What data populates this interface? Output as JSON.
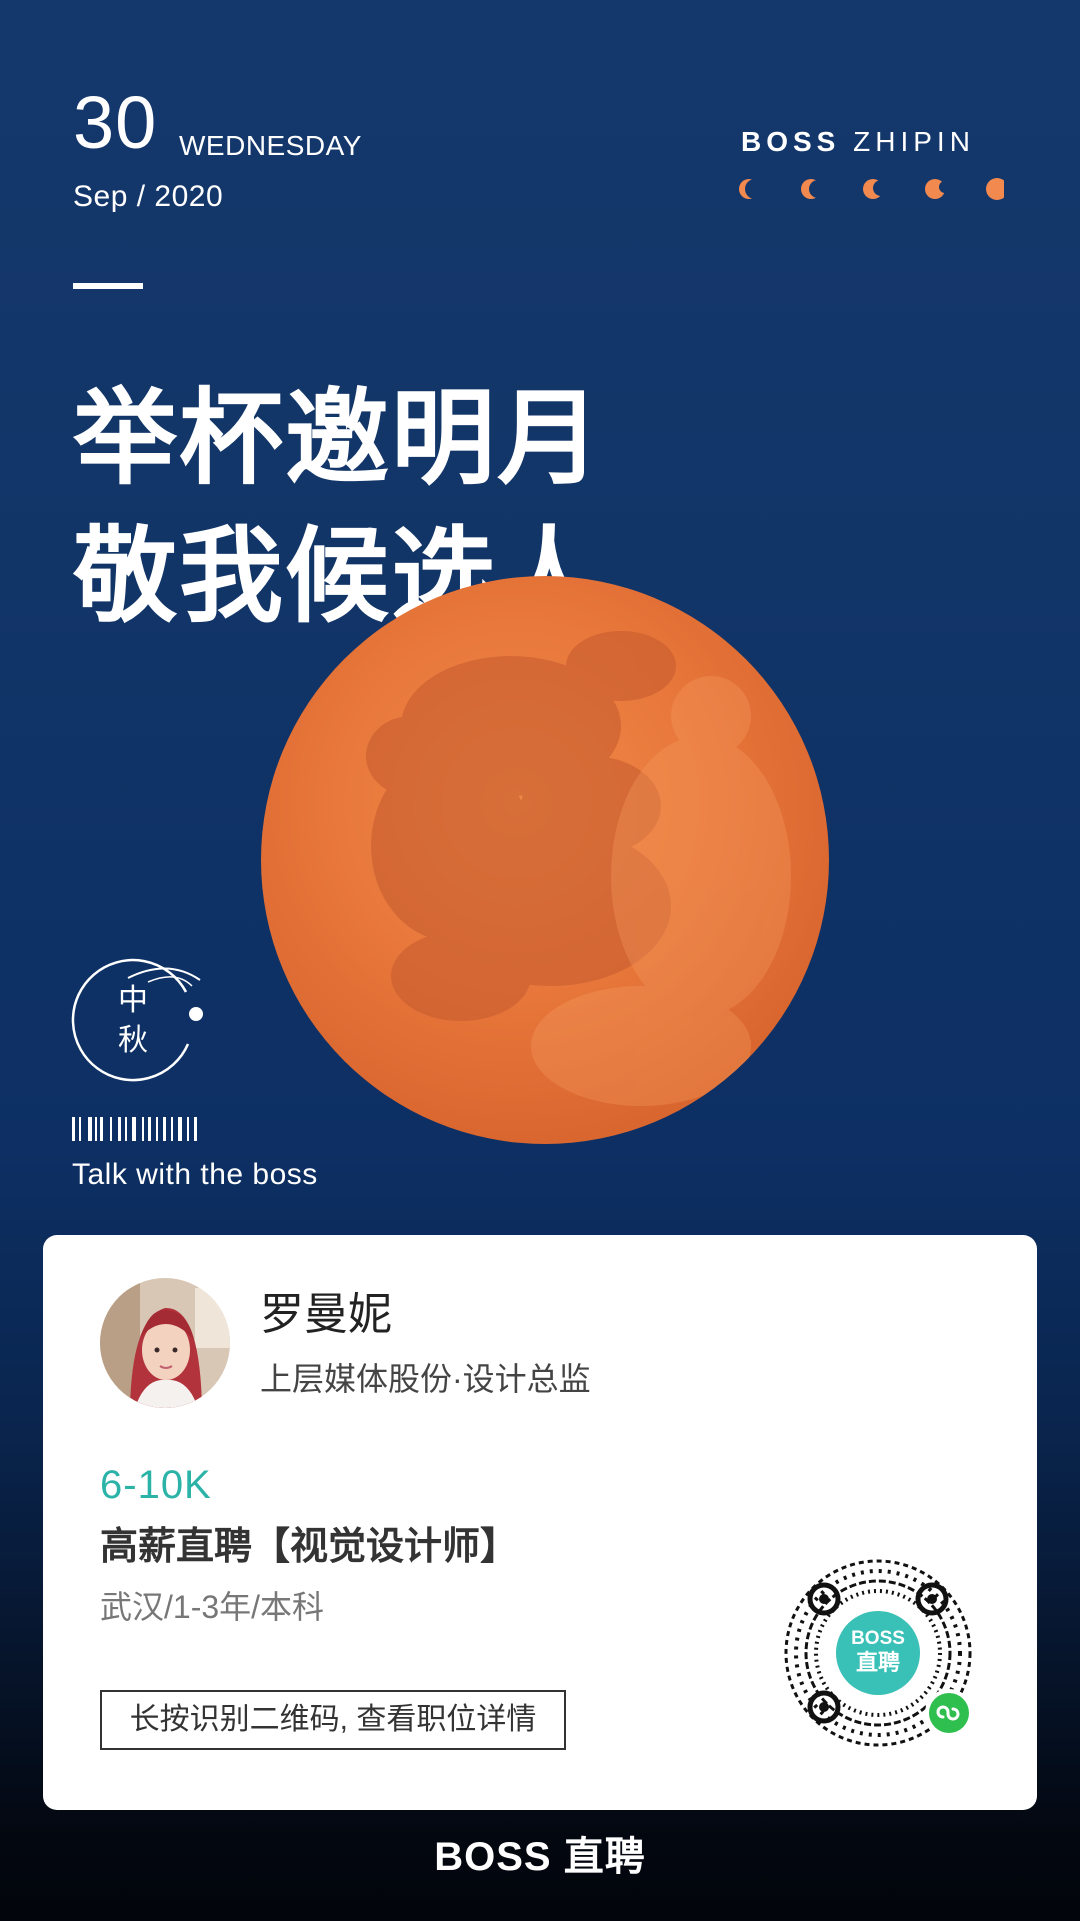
{
  "poster": {
    "date": {
      "day": "30",
      "weekday": "WEDNESDAY",
      "month_year": "Sep / 2020"
    },
    "brand_top": {
      "part1": "BOSS",
      "part2": "ZHIPIN"
    },
    "headline": {
      "line1": "举杯邀明月",
      "line2": "敬我候选人"
    },
    "seal": {
      "char1": "中",
      "char2": "秋"
    },
    "tagline": "Talk with the boss",
    "colors": {
      "background": "#123568",
      "moon": "#e8743a",
      "accent": "#2bb3a8",
      "qr_badge": "#3ac1b7"
    },
    "icons": [
      "moon-phase-icon",
      "mid-autumn-seal",
      "barcode-decoration",
      "qr-code",
      "mini-program-icon"
    ]
  },
  "card": {
    "recruiter": {
      "name": "罗曼妮",
      "company_role": "上层媒体股份·设计总监"
    },
    "job": {
      "salary": "6-10K",
      "title": "高薪直聘【视觉设计师】",
      "meta": "武汉/1-3年/本科"
    },
    "qr_hint": "长按识别二维码, 查看职位详情",
    "qr_badge": {
      "line1": "BOSS",
      "line2": "直聘"
    }
  },
  "footer": {
    "brand": "BOSS 直聘"
  }
}
